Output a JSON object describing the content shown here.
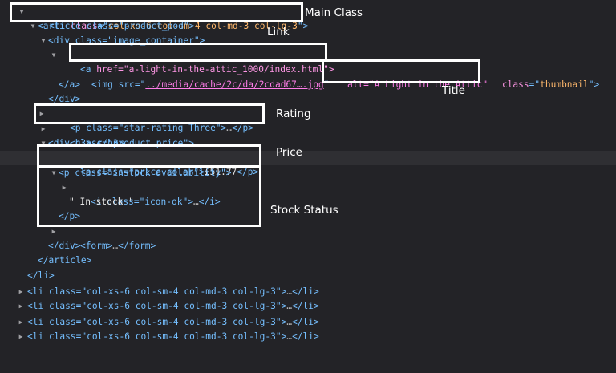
{
  "labels": {
    "main_class": "Main Class",
    "link": "Link",
    "title": "Title",
    "rating": "Rating",
    "price": "Price",
    "stock_status": "Stock Status"
  },
  "code": {
    "li_open": {
      "lt": "<",
      "tag": "li",
      "attr": "class",
      "eq": "=\"",
      "val": "col-xs-6 col-sm-4 col-md-3 col-lg-3",
      "close": "\">"
    },
    "article_open": "<article class=\"product_pod\">",
    "div_image_open": "<div class=\"image_container\">",
    "a_open": {
      "lt": "<a",
      "href": "href=\"a-light-in-the-attic_1000/index.html\">"
    },
    "img": {
      "start": "<img src=\"",
      "src": "../media/cache/2c/da/2cdad67….jpg",
      "end": "\"",
      "alt": "alt=\"A Light in the Attic\"",
      "class_name": "class",
      "class_eq": "=\"",
      "class_val": "thumbnail",
      "class_end": "\">"
    },
    "a_close": "</a>",
    "div_close": "</div>",
    "p_rating": {
      "open": "<p class=\"star-rating Three\">",
      "ell": "…",
      "close": "</p>"
    },
    "h3": {
      "open": "<h3>",
      "ell": "…",
      "close": "</h3>"
    },
    "div_price_open": "<div class=\"product_price\">",
    "p_price": {
      "open": "<p class=\"price color\">",
      "text": "£51.77",
      "close": "</p>"
    },
    "p_instock_open": "<p class=\"instock availability\">",
    "i_ok": {
      "open": "<i class=\"icon-ok\">",
      "ell": "…",
      "close": "</i>"
    },
    "in_stock_text": "\" In stock \"",
    "p_close": "</p>",
    "form": {
      "open": "<form>",
      "ell": "…",
      "close": "</form>"
    },
    "div_close2": "</div>",
    "article_close": "</article>",
    "li_close": "</li>",
    "li_collapsed": {
      "open": "<li class=\"col-xs-6 col-sm-4 col-md-3 col-lg-3\">",
      "ell": "…",
      "close": "</li>"
    }
  },
  "twisty": {
    "expanded": "▼",
    "collapsed": "▶"
  }
}
